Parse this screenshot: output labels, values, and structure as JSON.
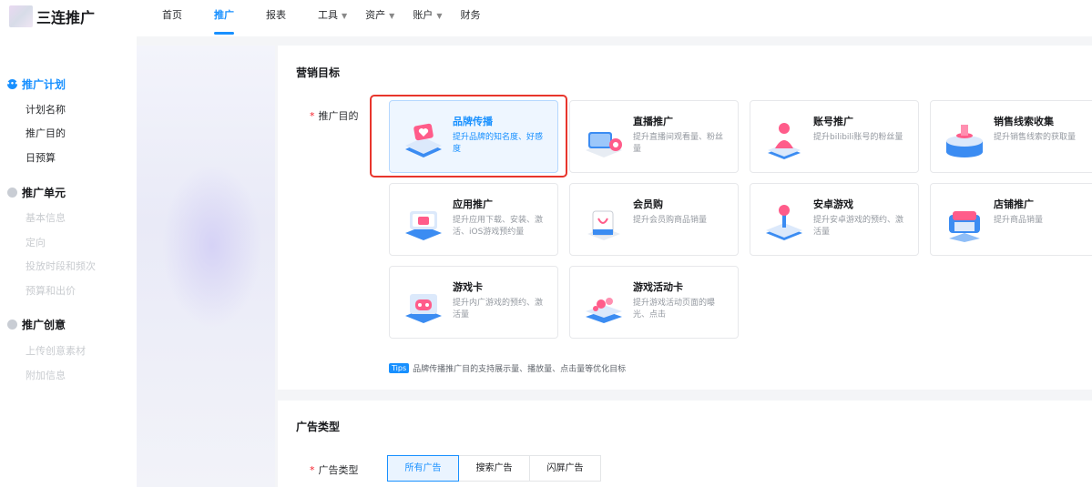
{
  "app": {
    "logo_text": "三连推广"
  },
  "nav": [
    {
      "label": "首页"
    },
    {
      "label": "推广"
    },
    {
      "label": "报表"
    },
    {
      "label": "工具"
    },
    {
      "label": "资产"
    },
    {
      "label": "账户"
    },
    {
      "label": "财务"
    }
  ],
  "sidebar": {
    "groups": [
      {
        "label": "推广计划",
        "items": [
          "计划名称",
          "推广目的",
          "日预算"
        ]
      },
      {
        "label": "推广单元",
        "items": [
          "基本信息",
          "定向",
          "投放时段和频次",
          "预算和出价"
        ]
      },
      {
        "label": "推广创意",
        "items": [
          "上传创意素材",
          "附加信息"
        ]
      }
    ]
  },
  "marketing": {
    "title": "营销目标",
    "purpose_label": "推广目的",
    "tiles": [
      {
        "title": "品牌传播",
        "desc": "提升品牌的知名度、好感度",
        "selected": true
      },
      {
        "title": "直播推广",
        "desc": "提升直播间观看量、粉丝量"
      },
      {
        "title": "账号推广",
        "desc": "提升bilibili账号的粉丝量"
      },
      {
        "title": "销售线索收集",
        "desc": "提升销售线索的获取量"
      },
      {
        "title": "应用推广",
        "desc": "提升应用下载、安装、激活、iOS游戏预约量"
      },
      {
        "title": "会员购",
        "desc": "提升会员购商品销量"
      },
      {
        "title": "安卓游戏",
        "desc": "提升安卓游戏的预约、激活量"
      },
      {
        "title": "店铺推广",
        "desc": "提升商品销量"
      },
      {
        "title": "游戏卡",
        "desc": "提升内广游戏的预约、激活量"
      },
      {
        "title": "游戏活动卡",
        "desc": "提升游戏活动页面的曝光、点击"
      }
    ],
    "tips_badge": "Tips",
    "tips_text": "品牌传播推广目的支持展示量、播放量、点击量等优化目标"
  },
  "adtype": {
    "title": "广告类型",
    "label": "广告类型",
    "options": [
      "所有广告",
      "搜索广告",
      "闪屏广告"
    ],
    "selected": "所有广告"
  },
  "colors": {
    "accent": "#1890ff",
    "highlight": "#e8352c",
    "required": "#f5222d"
  }
}
